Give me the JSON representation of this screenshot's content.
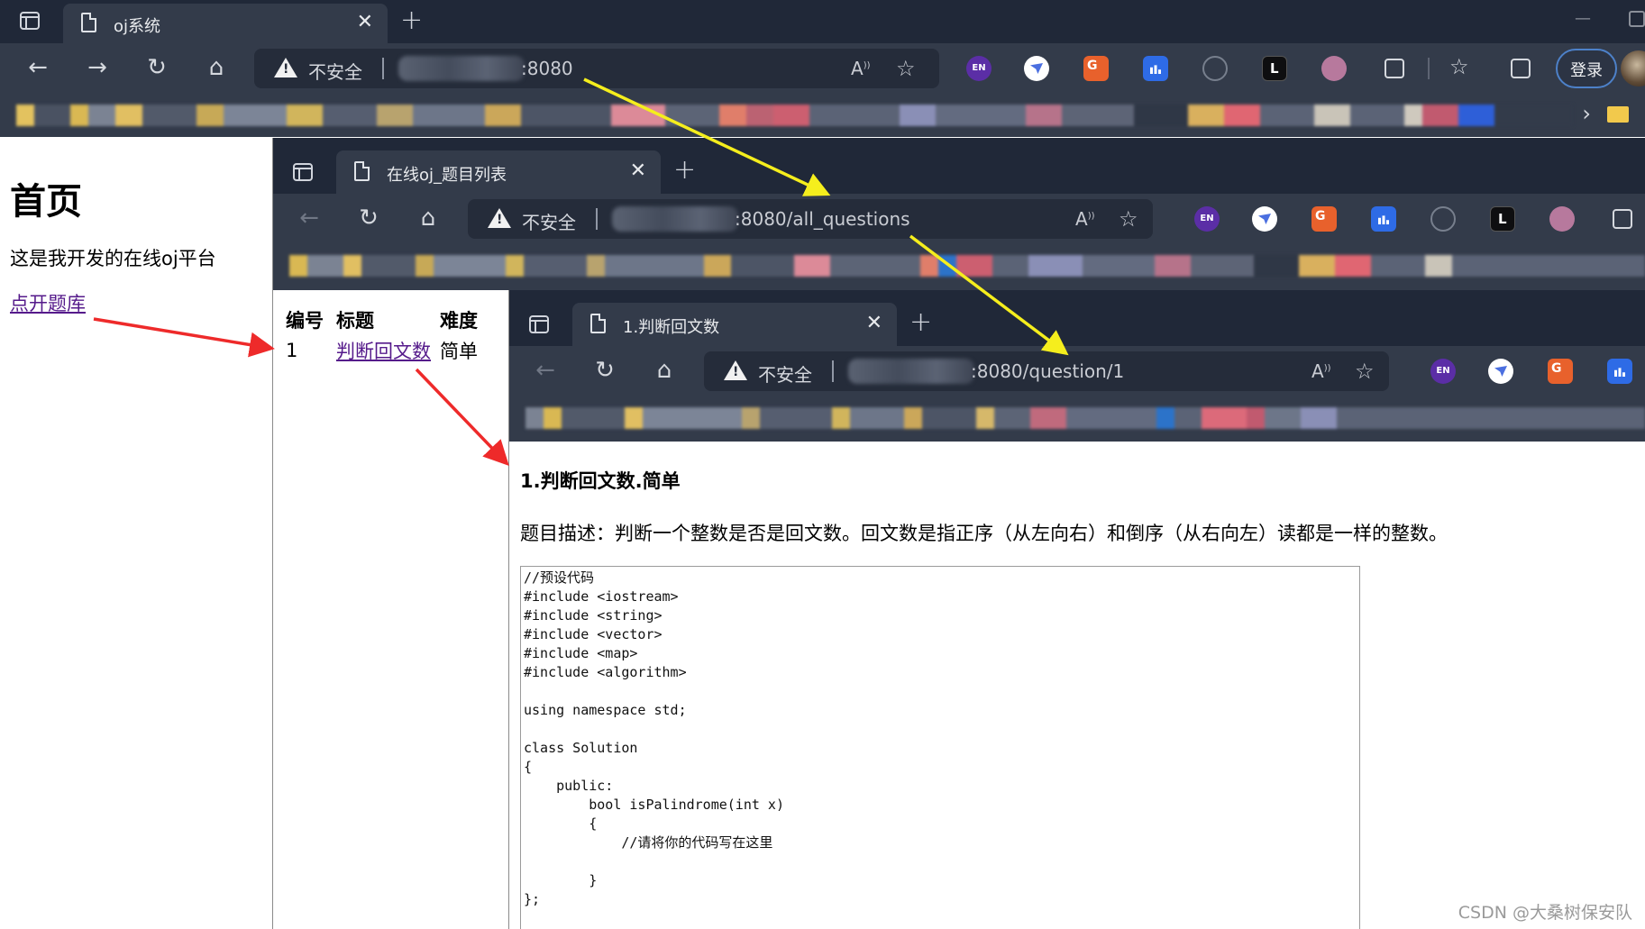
{
  "windows": [
    {
      "tab_title": "oj系统",
      "url_suffix": ":8080",
      "insecure_label": "不安全",
      "login_label": "登录",
      "page": {
        "heading": "首页",
        "intro": "这是我开发的在线oj平台",
        "link_label": "点开题库"
      }
    },
    {
      "tab_title": "在线oj_题目列表",
      "url_suffix": ":8080/all_questions",
      "insecure_label": "不安全",
      "table": {
        "headers": [
          "编号",
          "标题",
          "难度"
        ],
        "rows": [
          {
            "id": "1",
            "title": "判断回文数",
            "difficulty": "简单"
          }
        ]
      }
    },
    {
      "tab_title": "1.判断回文数",
      "url_suffix": ":8080/question/1",
      "insecure_label": "不安全",
      "page": {
        "title": "1.判断回文数.简单",
        "description": "题目描述：判断一个整数是否是回文数。回文数是指正序（从左向右）和倒序（从右向左）读都是一样的整数。",
        "code": "//预设代码\n#include <iostream>\n#include <string>\n#include <vector>\n#include <map>\n#include <algorithm>\n\nusing namespace std;\n\nclass Solution\n{\n    public:\n        bool isPalindrome(int x)\n        {\n            //请将你的代码写在这里\n\n        }\n};"
      }
    }
  ],
  "icons": {
    "back": "back-arrow-icon",
    "forward": "forward-arrow-icon",
    "refresh": "refresh-icon",
    "home": "home-icon",
    "close": "close-icon",
    "new_tab": "plus-icon",
    "extensions_en": "EN"
  },
  "colors": {
    "titlebar": "#202838",
    "toolbar": "#333b4a",
    "address_bar": "#252c3a",
    "link_visited": "#551a8b",
    "arrow_yellow": "#f5ee1d",
    "arrow_red": "#ee2a2a"
  },
  "watermark": "CSDN @大桑树保安队"
}
